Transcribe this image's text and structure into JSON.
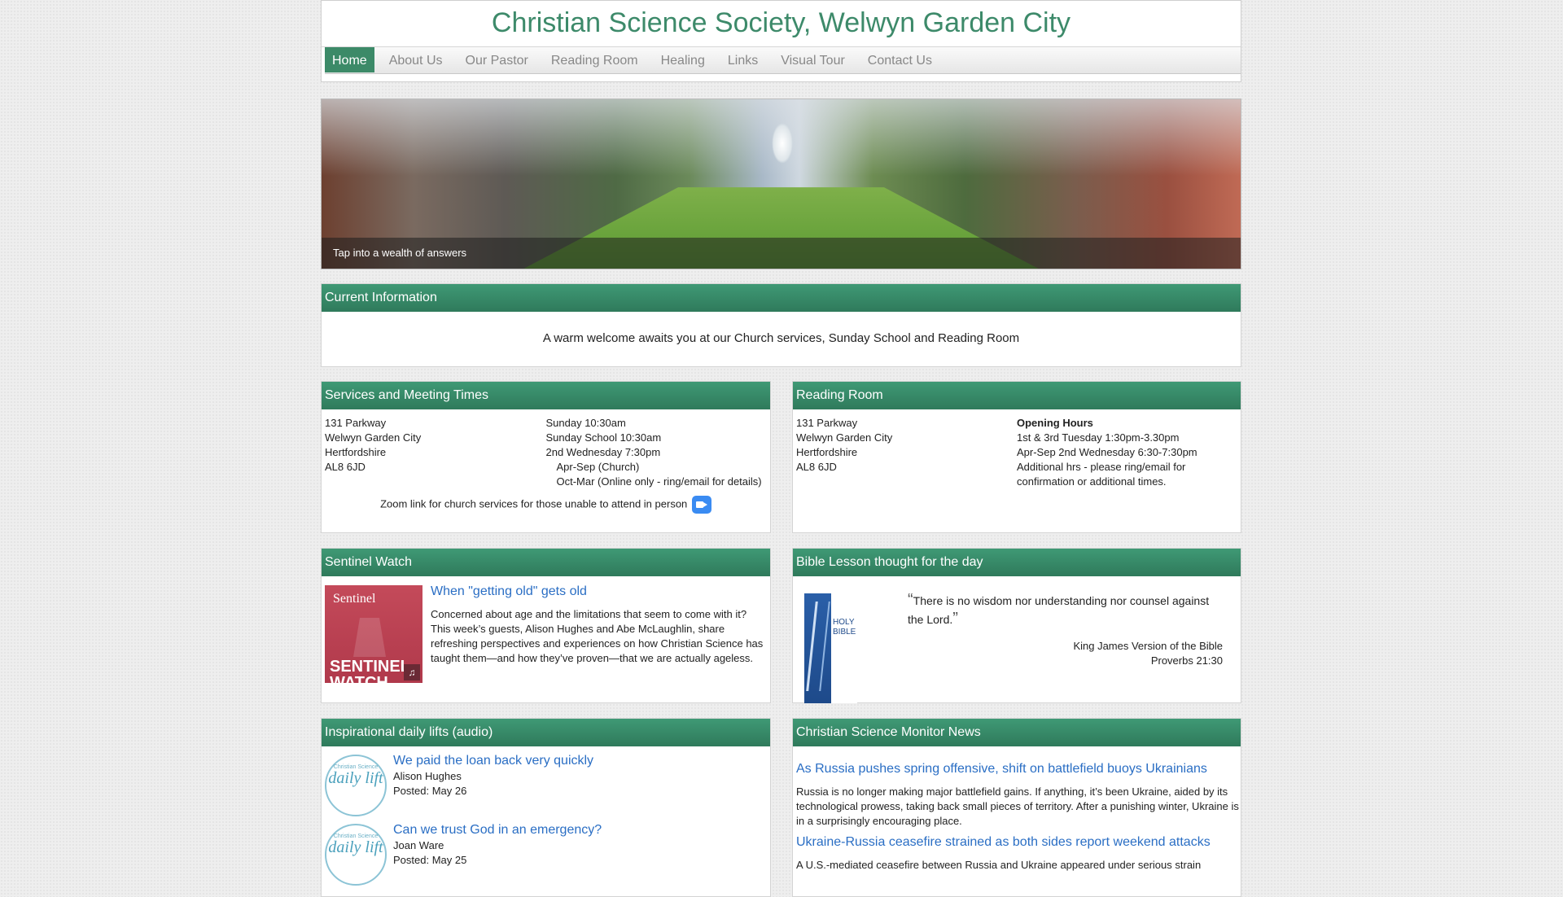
{
  "site": {
    "title": "Christian Science Society, Welwyn Garden City"
  },
  "nav": {
    "items": [
      "Home",
      "About Us",
      "Our Pastor",
      "Reading Room",
      "Healing",
      "Links",
      "Visual Tour",
      "Contact Us"
    ]
  },
  "hero": {
    "caption": "Tap into a wealth of answers"
  },
  "current_info": {
    "heading": "Current Information",
    "text": "A warm welcome awaits you at our Church services, Sunday School and Reading Room"
  },
  "services": {
    "heading": "Services and Meeting Times",
    "address": [
      "131 Parkway",
      "Welwyn Garden City",
      "Hertfordshire",
      "AL8 6JD"
    ],
    "times": [
      "Sunday 10:30am",
      "Sunday School 10:30am",
      "2nd Wednesday 7:30pm"
    ],
    "wed_notes": [
      "Apr-Sep (Church)",
      "Oct-Mar (Online only - ring/email for details)"
    ],
    "zoom_text": "Zoom link for church services for those unable to attend in person"
  },
  "reading_room": {
    "heading": "Reading Room",
    "address": [
      "131 Parkway",
      "Welwyn Garden City",
      "Hertfordshire",
      "AL8 6JD"
    ],
    "hours_title": "Opening Hours",
    "hours": [
      "1st & 3rd Tuesday 1:30pm-3.30pm",
      "Apr-Sep 2nd Wednesday 6:30-7:30pm",
      "Additional hrs - please ring/email for confirmation or additional times."
    ]
  },
  "sentinel": {
    "heading": "Sentinel Watch",
    "image_top": "Sentinel",
    "image_bottom": "SENTINEL WATCH",
    "title": "When \"getting old\" gets old",
    "body": "Concerned about age and the limitations that seem to come with it? This week’s guests, Alison Hughes and Abe McLaughlin, share refreshing perspectives and experiences on how Christian Science has taught them—and how they’ve proven—that we are actually ageless."
  },
  "bible_lesson": {
    "heading": "Bible Lesson thought for the day",
    "book_label": "HOLY BIBLE",
    "open_quote": "“",
    "close_quote": "”",
    "quote": "There is no wisdom nor understanding nor counsel against the Lord.",
    "source": "King James Version of the Bible",
    "reference": "Proverbs 21:30"
  },
  "daily_lifts": {
    "heading": "Inspirational daily lifts (audio)",
    "icon_top": "Christian Science",
    "icon_word": "daily lift",
    "items": [
      {
        "title": "We paid the loan back very quickly",
        "author": "Alison Hughes",
        "posted": "Posted: May 26"
      },
      {
        "title": "Can we trust God in an emergency?",
        "author": "Joan Ware",
        "posted": "Posted: May 25"
      }
    ]
  },
  "monitor": {
    "heading": "Christian Science Monitor News",
    "items": [
      {
        "title": "As Russia pushes spring offensive, shift on battlefield buoys Ukrainians",
        "body": "Russia is no longer making major battlefield gains. If anything, it’s been Ukraine, aided by its technological prowess, taking back small pieces of territory. After a punishing winter, Ukraine is in a surprisingly encouraging place."
      },
      {
        "title": "Ukraine-Russia ceasefire strained as both sides report weekend attacks",
        "body": "A U.S.-mediated ceasefire between Russia and Ukraine appeared under serious strain"
      }
    ]
  },
  "colors": {
    "accent": "#3c8a68",
    "title": "#3d8a6a",
    "link": "#2a6ec4"
  }
}
